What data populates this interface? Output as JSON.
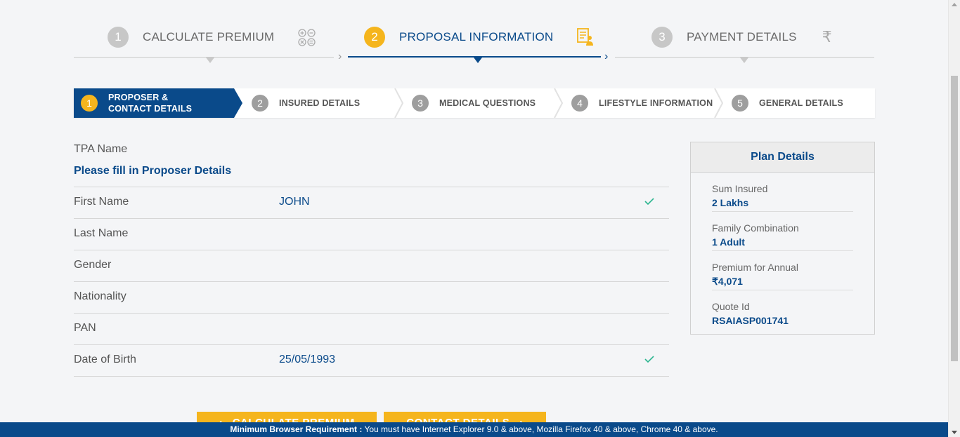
{
  "top_steps": [
    {
      "num": "1",
      "label": "CALCULATE PREMIUM",
      "icon": "calculator-icon"
    },
    {
      "num": "2",
      "label": "PROPOSAL INFORMATION",
      "icon": "proposal-document-icon"
    },
    {
      "num": "3",
      "label": "PAYMENT DETAILS",
      "icon": "rupee-icon"
    }
  ],
  "rupee_glyph": "₹",
  "sub_steps": [
    {
      "num": "1",
      "label_line1": "PROPOSER &",
      "label_line2": "CONTACT DETAILS"
    },
    {
      "num": "2",
      "label": "INSURED DETAILS"
    },
    {
      "num": "3",
      "label": "MEDICAL QUESTIONS"
    },
    {
      "num": "4",
      "label": "LIFESTYLE INFORMATION"
    },
    {
      "num": "5",
      "label": "GENERAL DETAILS"
    }
  ],
  "form": {
    "tpa_label": "TPA Name",
    "section_title": "Please fill in Proposer Details",
    "fields": [
      {
        "label": "First Name",
        "value": "JOHN",
        "valid": true
      },
      {
        "label": "Last Name",
        "value": "",
        "valid": false
      },
      {
        "label": "Gender",
        "value": "",
        "valid": false
      },
      {
        "label": "Nationality",
        "value": "",
        "valid": false
      },
      {
        "label": "PAN",
        "value": "",
        "valid": false
      },
      {
        "label": "Date of Birth",
        "value": "25/05/1993",
        "valid": true
      }
    ]
  },
  "plan": {
    "title": "Plan Details",
    "items": [
      {
        "key": "Sum Insured",
        "value": "2 Lakhs"
      },
      {
        "key": "Family Combination",
        "value": "1 Adult"
      },
      {
        "key": "Premium for Annual",
        "value": "₹4,071"
      },
      {
        "key": "Quote Id",
        "value": "RSAIASP001741"
      }
    ]
  },
  "buttons": {
    "back": "CALCULATE PREMIUM",
    "next": "CONTACT DETAILS"
  },
  "banner": {
    "bold": "Minimum Browser Requirement :",
    "text": " You must have Internet Explorer 9.0 & above, Mozilla Firefox 40 & above, Chrome 40 & above."
  },
  "colors": {
    "brand_blue": "#0a4a8a",
    "accent_yellow": "#f5b51d",
    "check_green": "#2bb58f"
  }
}
